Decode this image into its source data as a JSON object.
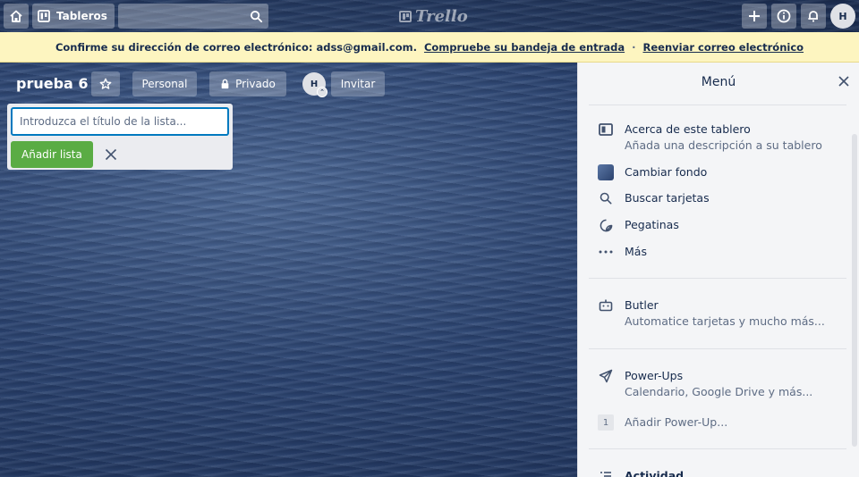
{
  "header": {
    "boards_label": "Tableros",
    "logo_text": "Trello",
    "avatar_initial": "H"
  },
  "banner": {
    "message": "Confirme su dirección de correo electrónico: adss@gmail.com.",
    "check_inbox_link": "Compruebe su bandeja de entrada",
    "separator": "·",
    "resend_link": "Reenviar correo electrónico"
  },
  "board": {
    "title": "prueba 6",
    "personal_label": "Personal",
    "private_label": "Privado",
    "member_initial": "H",
    "invite_label": "Invitar"
  },
  "add_list": {
    "placeholder": "Introduzca el título de la lista...",
    "add_button": "Añadir lista"
  },
  "menu": {
    "title": "Menú",
    "about": {
      "title": "Acerca de este tablero",
      "subtitle": "Añada una descripción a su tablero"
    },
    "change_bg": "Cambiar fondo",
    "search_cards": "Buscar tarjetas",
    "stickers": "Pegatinas",
    "more": "Más",
    "butler": {
      "title": "Butler",
      "subtitle": "Automatice tarjetas y mucho más..."
    },
    "powerups": {
      "title": "Power-Ups",
      "subtitle": "Calendario, Google Drive y más..."
    },
    "add_powerup": {
      "count": "1",
      "label": "Añadir Power-Up..."
    },
    "activity": "Actividad"
  },
  "colors": {
    "accent": "#0079bf",
    "success": "#5aac44",
    "banner_bg": "#fdf5c0"
  }
}
